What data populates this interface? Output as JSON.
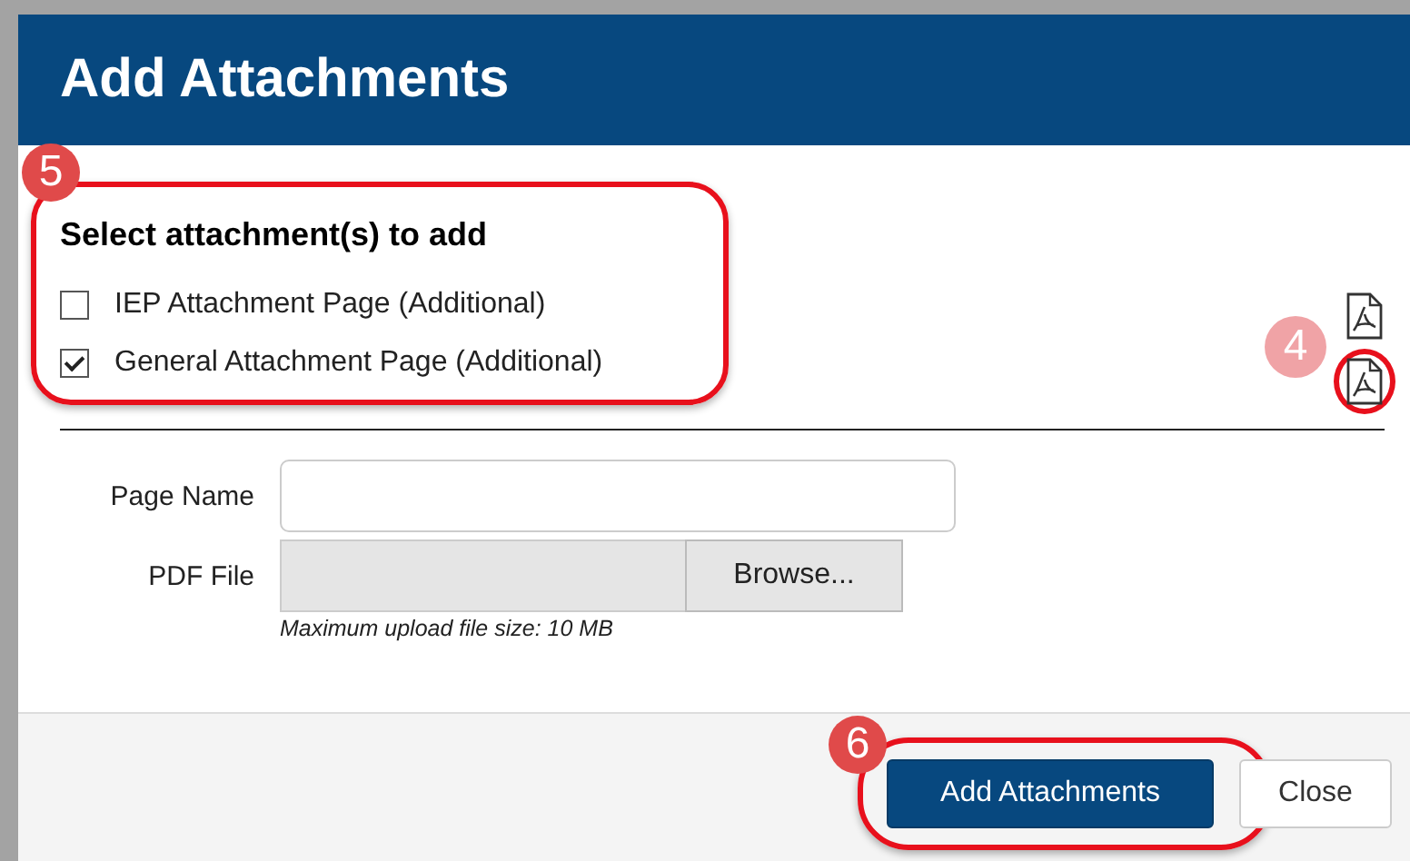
{
  "dialog": {
    "title": "Add Attachments"
  },
  "attachments": {
    "heading": "Select attachment(s) to add",
    "callout": {
      "label": "5",
      "faded": false
    },
    "options": [
      {
        "label": "IEP Attachment Page (Additional)",
        "checked": false
      },
      {
        "label": "General Attachment Page (Additional)",
        "checked": true
      }
    ]
  },
  "pdf_icons": {
    "callout": {
      "label": "4",
      "faded": true
    },
    "items": [
      {
        "highlighted": false
      },
      {
        "highlighted": true
      }
    ]
  },
  "form": {
    "page_name": {
      "label": "Page Name"
    },
    "pdf_file": {
      "label": "PDF File",
      "button": "Browse...",
      "hint": "Maximum upload file size: 10 MB"
    }
  },
  "footer": {
    "buttons": [
      {
        "label": "Add Attachments",
        "kind": "primary",
        "callout": {
          "label": "6",
          "faded": false
        }
      },
      {
        "label": "Close",
        "kind": "secondary"
      }
    ]
  }
}
